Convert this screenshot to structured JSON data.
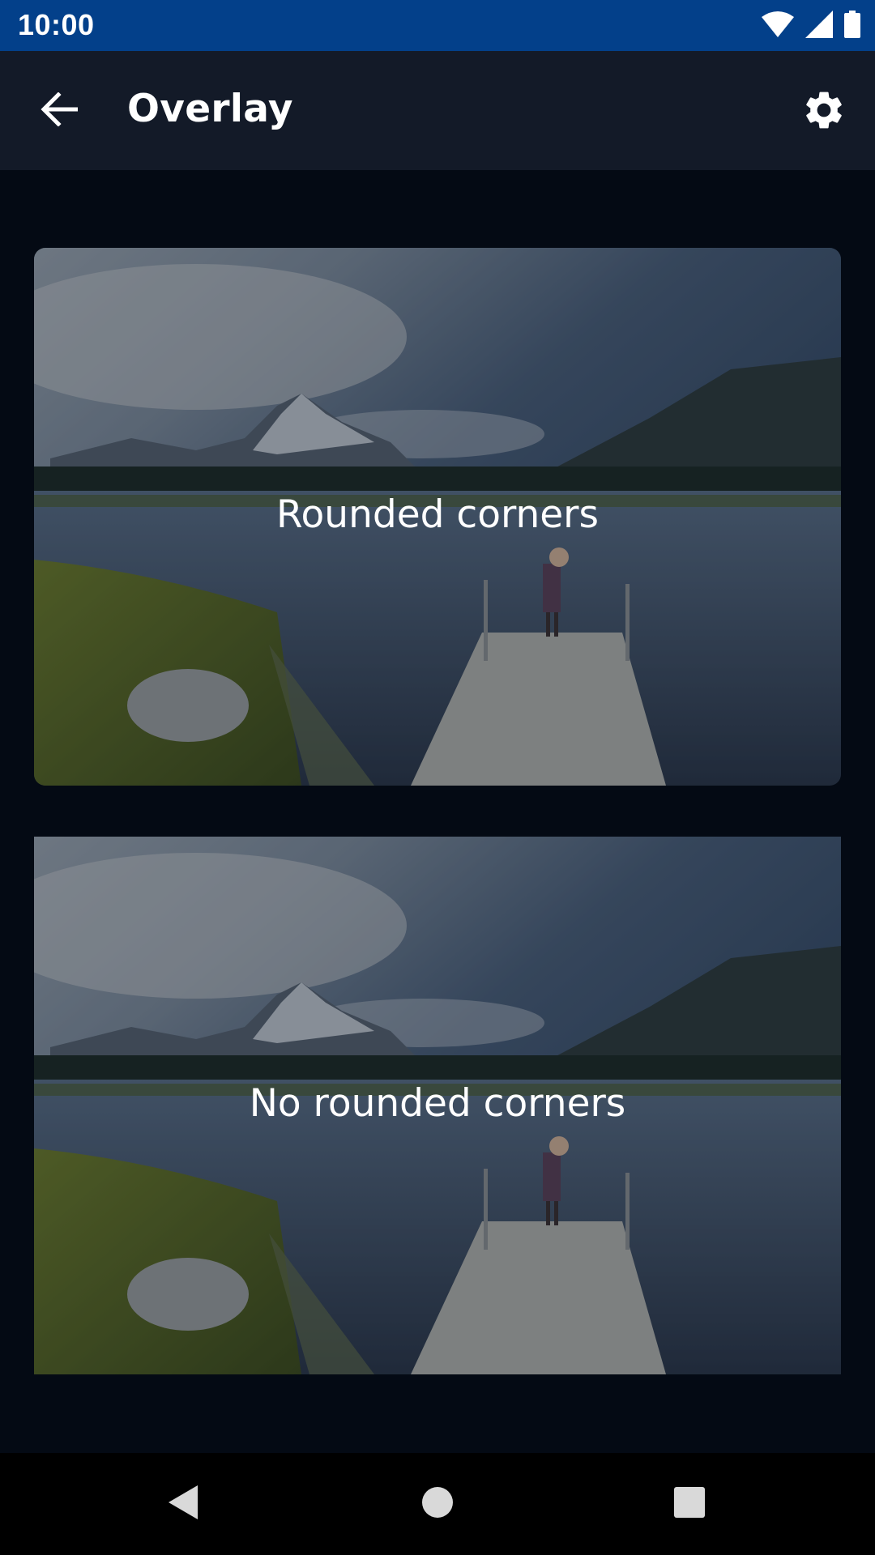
{
  "status_bar": {
    "time": "10:00",
    "icons": [
      "wifi-icon",
      "signal-icon",
      "battery-icon"
    ],
    "background": "#03408a"
  },
  "toolbar": {
    "title": "Overlay",
    "back_icon": "arrow-back-icon",
    "settings_icon": "gear-icon",
    "background": "#131a28"
  },
  "cards": [
    {
      "label": "Rounded corners",
      "style": "rounded"
    },
    {
      "label": "No rounded corners",
      "style": "square"
    }
  ],
  "nav_bar": {
    "icons": [
      "back-triangle-icon",
      "home-circle-icon",
      "recents-square-icon"
    ]
  }
}
